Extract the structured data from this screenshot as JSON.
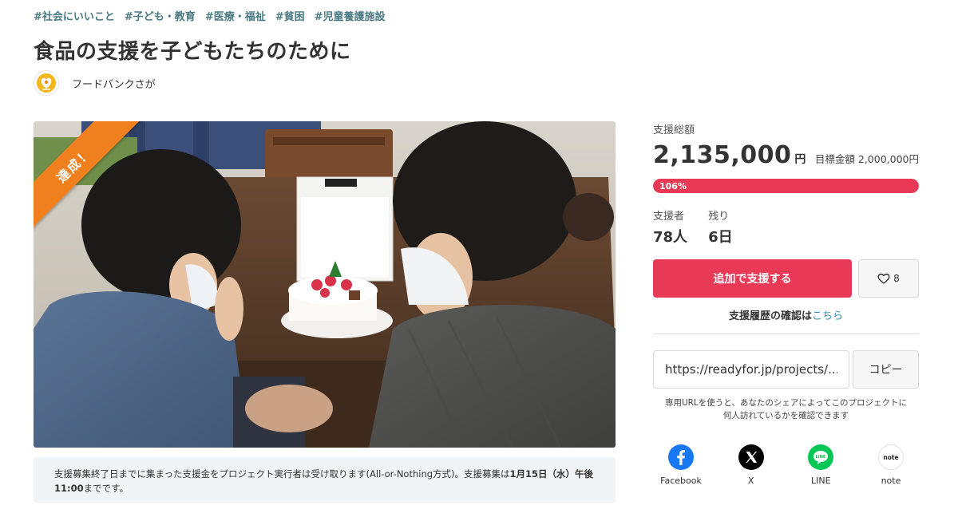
{
  "tags": [
    "#社会にいいこと",
    "#子ども・教育",
    "#医療・福祉",
    "#貧困",
    "#児童養護施設"
  ],
  "title": "食品の支援を子どもたちのために",
  "org": {
    "name": "フードバンクさが"
  },
  "hero": {
    "badge": "達成！"
  },
  "notice": {
    "text": "支援募集終了日までに集まった支援金をプロジェクト実行者は受け取ります(All-or-Nothing方式)。支援募集は",
    "deadline": "1月15日（水）午後11:00",
    "suffix": "までです。"
  },
  "funding": {
    "label": "支援総額",
    "amount": "2,135,000",
    "unit": "円",
    "target": "目標金額 2,000,000円",
    "progress_text": "106%",
    "progress_fraction": 1.0
  },
  "stats": {
    "supporters_label": "支援者",
    "supporters_value": "78人",
    "remaining_label": "残り",
    "remaining_value": "6日"
  },
  "actions": {
    "support_label": "追加で支援する",
    "like_count": "8",
    "history_prefix": "支援履歴の確認は",
    "history_link": "こちら"
  },
  "share": {
    "url": "https://readyfor.jp/projects/...",
    "copy_label": "コピー",
    "note": "専用URLを使うと、あなたのシェアによってこのプロジェクトに何人訪れているかを確認できます"
  },
  "sns": [
    {
      "name": "Facebook",
      "icon": "facebook-icon",
      "color": "#1877f2"
    },
    {
      "name": "X",
      "icon": "x-icon",
      "color": "#000000"
    },
    {
      "name": "LINE",
      "icon": "line-icon",
      "color": "#06c755"
    },
    {
      "name": "note",
      "icon": "note-icon",
      "color": "#222222"
    }
  ],
  "colors": {
    "accent": "#e83a56",
    "ribbon": "#f07f1e",
    "tag": "#4a7a82",
    "link": "#3a8fb5"
  }
}
